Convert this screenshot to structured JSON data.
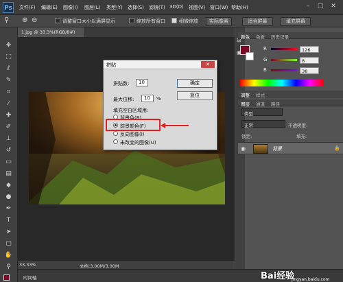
{
  "app": {
    "logo": "Ps"
  },
  "menu": [
    "文件(F)",
    "编辑(E)",
    "图像(I)",
    "图层(L)",
    "类型(Y)",
    "选择(S)",
    "滤镜(T)",
    "3D(D)",
    "视图(V)",
    "窗口(W)",
    "帮助(H)"
  ],
  "window_controls": {
    "minimize": "–",
    "maximize": "□",
    "close": "✕"
  },
  "options_bar": {
    "resize_window": "调整窗口大小以满屏显示",
    "zoom_all": "缩放所有窗口",
    "scrubby_zoom": "细微缩放",
    "actual_pixels": "实际像素",
    "fit_screen": "适合屏幕",
    "fill_screen": "填充屏幕"
  },
  "document": {
    "tab": "1.jpg @ 33.3%(RGB/8#)",
    "tab_close": "×"
  },
  "status": {
    "zoom": "33.33%",
    "doc": "文档:3.00M/3.00M"
  },
  "timeline": {
    "label": "时间轴"
  },
  "panels": {
    "color_tabs": [
      "颜色",
      "色板",
      "历史记录"
    ],
    "color": {
      "r_label": "R",
      "g_label": "G",
      "b_label": "B",
      "r": "126",
      "g": "8",
      "b": "38",
      "fg_color": "#7e0826"
    },
    "adjust_tabs": [
      "调整",
      "样式"
    ],
    "layers_tabs": [
      "图层",
      "通道",
      "路径"
    ],
    "layers": {
      "filter": "类型",
      "blend": "正常",
      "opacity_label": "不透明度:",
      "lock_label": "锁定:",
      "fill_label": "填充:",
      "layer_name": "背景"
    }
  },
  "dialog": {
    "title": "拼贴",
    "close": "✕",
    "count_label": "拼贴数:",
    "count": "10",
    "offset_label": "最大位移:",
    "offset": "10",
    "percent": "%",
    "ok": "确定",
    "reset": "复位",
    "fill_group": "填充空白区域用:",
    "options": [
      "背景色(B)",
      "前景颜色(F)",
      "反向图像(I)",
      "未改变的图像(U)"
    ],
    "selected_index": 1
  },
  "watermark": {
    "brand": "Bai经验",
    "url": "jingyan.baidu.com"
  }
}
